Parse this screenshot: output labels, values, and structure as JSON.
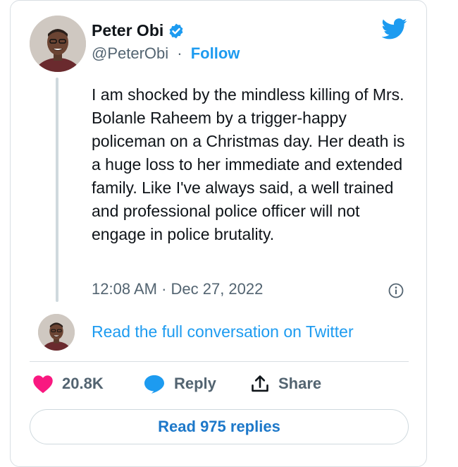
{
  "author": {
    "name": "Peter Obi",
    "handle": "@PeterObi",
    "separator": "·",
    "follow_label": "Follow"
  },
  "tweet": {
    "text": "I am shocked by the mindless killing of Mrs. Bolanle Raheem by a trigger-happy policeman on a Christmas day. Her death is a huge loss to her immediate and extended family. Like I've always said, a well trained and professional police officer will not engage in police brutality.",
    "timestamp": "12:08 AM · Dec 27, 2022"
  },
  "conversation": {
    "read_full_label": "Read the full conversation on Twitter"
  },
  "actions": {
    "likes": "20.8K",
    "reply_label": "Reply",
    "share_label": "Share"
  },
  "replies_button": {
    "label": "Read 975 replies"
  },
  "icons": {
    "verified": "verified-badge-icon",
    "brand": "twitter-bird-icon",
    "info": "info-icon",
    "like": "heart-icon",
    "reply": "speech-bubble-icon",
    "share": "share-upload-icon"
  },
  "colors": {
    "accent": "#1d9bf0",
    "like": "#f91880",
    "secondary_text": "#536471"
  }
}
